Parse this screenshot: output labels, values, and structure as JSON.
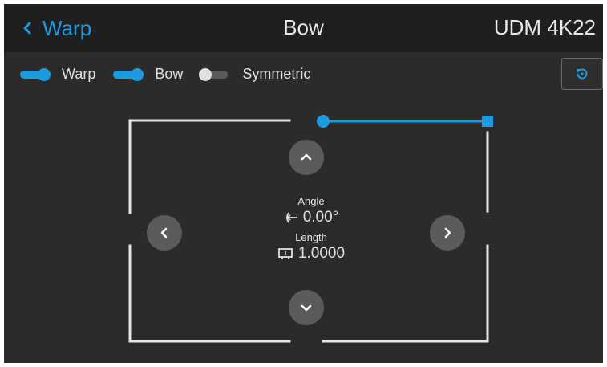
{
  "header": {
    "back_label": "Warp",
    "title": "Bow",
    "model": "UDM 4K22"
  },
  "toggles": [
    {
      "label": "Warp",
      "on": true
    },
    {
      "label": "Bow",
      "on": true
    },
    {
      "label": "Symmetric",
      "on": false
    }
  ],
  "readout": {
    "angle_label": "Angle",
    "angle_value": "0.00°",
    "length_label": "Length",
    "length_value": "1.0000"
  },
  "icons": {
    "back": "chevron-left-icon",
    "reset": "reset-icon",
    "up": "chevron-up-icon",
    "down": "chevron-down-icon",
    "left": "chevron-left-icon",
    "right": "chevron-right-icon",
    "angle": "angle-icon",
    "length": "length-icon"
  },
  "colors": {
    "accent": "#1e9be0",
    "background": "#2b2b2b",
    "header": "#1f1f1f",
    "button": "#5b5b5b"
  }
}
